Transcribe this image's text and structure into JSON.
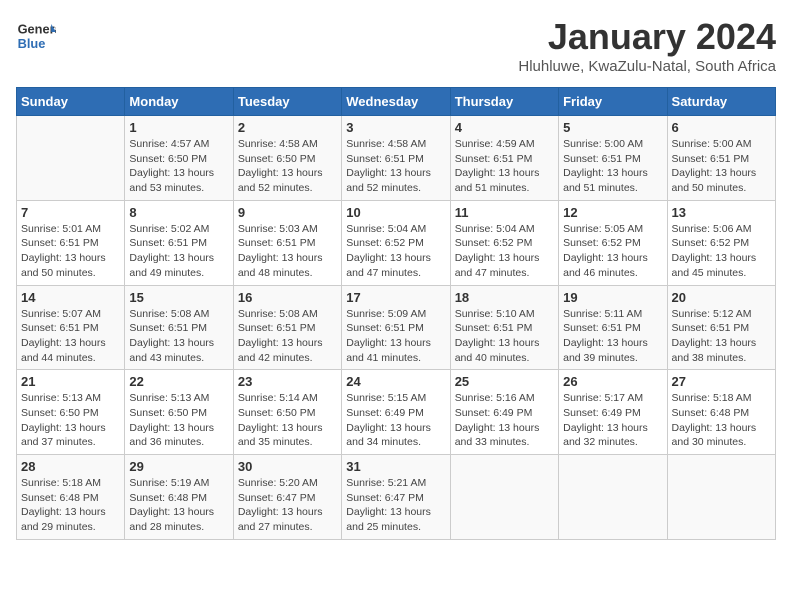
{
  "header": {
    "logo_line1": "General",
    "logo_line2": "Blue",
    "month": "January 2024",
    "location": "Hluhluwe, KwaZulu-Natal, South Africa"
  },
  "days_of_week": [
    "Sunday",
    "Monday",
    "Tuesday",
    "Wednesday",
    "Thursday",
    "Friday",
    "Saturday"
  ],
  "weeks": [
    [
      {
        "day": "",
        "content": ""
      },
      {
        "day": "1",
        "content": "Sunrise: 4:57 AM\nSunset: 6:50 PM\nDaylight: 13 hours\nand 53 minutes."
      },
      {
        "day": "2",
        "content": "Sunrise: 4:58 AM\nSunset: 6:50 PM\nDaylight: 13 hours\nand 52 minutes."
      },
      {
        "day": "3",
        "content": "Sunrise: 4:58 AM\nSunset: 6:51 PM\nDaylight: 13 hours\nand 52 minutes."
      },
      {
        "day": "4",
        "content": "Sunrise: 4:59 AM\nSunset: 6:51 PM\nDaylight: 13 hours\nand 51 minutes."
      },
      {
        "day": "5",
        "content": "Sunrise: 5:00 AM\nSunset: 6:51 PM\nDaylight: 13 hours\nand 51 minutes."
      },
      {
        "day": "6",
        "content": "Sunrise: 5:00 AM\nSunset: 6:51 PM\nDaylight: 13 hours\nand 50 minutes."
      }
    ],
    [
      {
        "day": "7",
        "content": "Sunrise: 5:01 AM\nSunset: 6:51 PM\nDaylight: 13 hours\nand 50 minutes."
      },
      {
        "day": "8",
        "content": "Sunrise: 5:02 AM\nSunset: 6:51 PM\nDaylight: 13 hours\nand 49 minutes."
      },
      {
        "day": "9",
        "content": "Sunrise: 5:03 AM\nSunset: 6:51 PM\nDaylight: 13 hours\nand 48 minutes."
      },
      {
        "day": "10",
        "content": "Sunrise: 5:04 AM\nSunset: 6:52 PM\nDaylight: 13 hours\nand 47 minutes."
      },
      {
        "day": "11",
        "content": "Sunrise: 5:04 AM\nSunset: 6:52 PM\nDaylight: 13 hours\nand 47 minutes."
      },
      {
        "day": "12",
        "content": "Sunrise: 5:05 AM\nSunset: 6:52 PM\nDaylight: 13 hours\nand 46 minutes."
      },
      {
        "day": "13",
        "content": "Sunrise: 5:06 AM\nSunset: 6:52 PM\nDaylight: 13 hours\nand 45 minutes."
      }
    ],
    [
      {
        "day": "14",
        "content": "Sunrise: 5:07 AM\nSunset: 6:51 PM\nDaylight: 13 hours\nand 44 minutes."
      },
      {
        "day": "15",
        "content": "Sunrise: 5:08 AM\nSunset: 6:51 PM\nDaylight: 13 hours\nand 43 minutes."
      },
      {
        "day": "16",
        "content": "Sunrise: 5:08 AM\nSunset: 6:51 PM\nDaylight: 13 hours\nand 42 minutes."
      },
      {
        "day": "17",
        "content": "Sunrise: 5:09 AM\nSunset: 6:51 PM\nDaylight: 13 hours\nand 41 minutes."
      },
      {
        "day": "18",
        "content": "Sunrise: 5:10 AM\nSunset: 6:51 PM\nDaylight: 13 hours\nand 40 minutes."
      },
      {
        "day": "19",
        "content": "Sunrise: 5:11 AM\nSunset: 6:51 PM\nDaylight: 13 hours\nand 39 minutes."
      },
      {
        "day": "20",
        "content": "Sunrise: 5:12 AM\nSunset: 6:51 PM\nDaylight: 13 hours\nand 38 minutes."
      }
    ],
    [
      {
        "day": "21",
        "content": "Sunrise: 5:13 AM\nSunset: 6:50 PM\nDaylight: 13 hours\nand 37 minutes."
      },
      {
        "day": "22",
        "content": "Sunrise: 5:13 AM\nSunset: 6:50 PM\nDaylight: 13 hours\nand 36 minutes."
      },
      {
        "day": "23",
        "content": "Sunrise: 5:14 AM\nSunset: 6:50 PM\nDaylight: 13 hours\nand 35 minutes."
      },
      {
        "day": "24",
        "content": "Sunrise: 5:15 AM\nSunset: 6:49 PM\nDaylight: 13 hours\nand 34 minutes."
      },
      {
        "day": "25",
        "content": "Sunrise: 5:16 AM\nSunset: 6:49 PM\nDaylight: 13 hours\nand 33 minutes."
      },
      {
        "day": "26",
        "content": "Sunrise: 5:17 AM\nSunset: 6:49 PM\nDaylight: 13 hours\nand 32 minutes."
      },
      {
        "day": "27",
        "content": "Sunrise: 5:18 AM\nSunset: 6:48 PM\nDaylight: 13 hours\nand 30 minutes."
      }
    ],
    [
      {
        "day": "28",
        "content": "Sunrise: 5:18 AM\nSunset: 6:48 PM\nDaylight: 13 hours\nand 29 minutes."
      },
      {
        "day": "29",
        "content": "Sunrise: 5:19 AM\nSunset: 6:48 PM\nDaylight: 13 hours\nand 28 minutes."
      },
      {
        "day": "30",
        "content": "Sunrise: 5:20 AM\nSunset: 6:47 PM\nDaylight: 13 hours\nand 27 minutes."
      },
      {
        "day": "31",
        "content": "Sunrise: 5:21 AM\nSunset: 6:47 PM\nDaylight: 13 hours\nand 25 minutes."
      },
      {
        "day": "",
        "content": ""
      },
      {
        "day": "",
        "content": ""
      },
      {
        "day": "",
        "content": ""
      }
    ]
  ]
}
